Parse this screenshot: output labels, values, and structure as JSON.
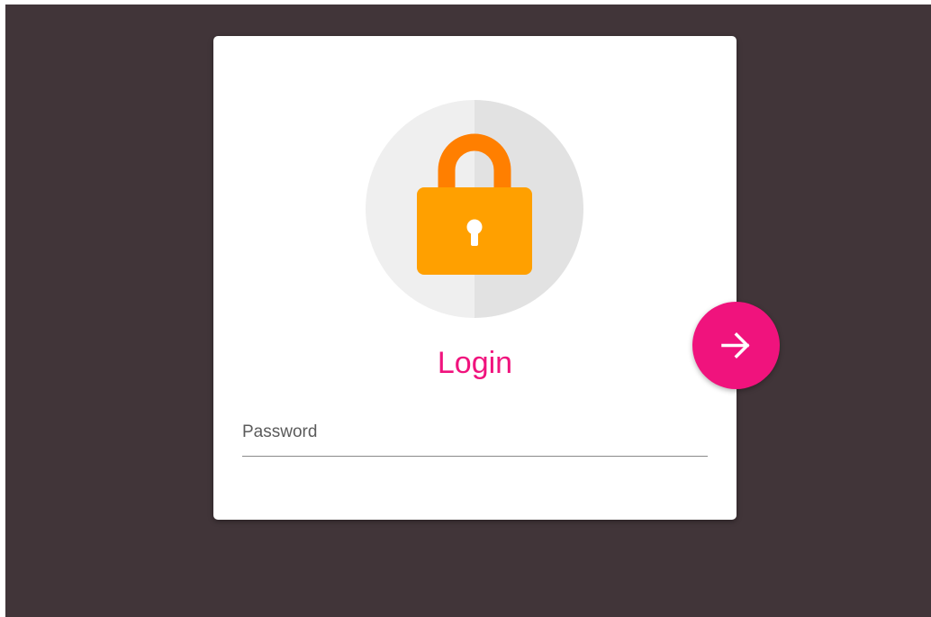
{
  "login": {
    "title": "Login",
    "password_placeholder": "Password",
    "password_value": "",
    "submit_icon": "arrow-right-icon",
    "lock_icon": "padlock-icon"
  },
  "colors": {
    "background": "#413539",
    "card": "#ffffff",
    "accent": "#f0137d",
    "lock_body": "#ffa000",
    "lock_shackle": "#ff7f00",
    "circle_light": "#efefef",
    "circle_dark": "#e2e2e2"
  }
}
